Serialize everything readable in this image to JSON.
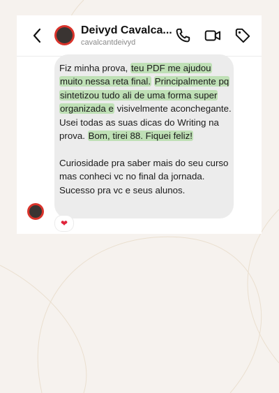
{
  "header": {
    "name": "Deivyd Cavalca...",
    "handle": "cavalcantdeivyd",
    "icons": [
      "back-arrow-icon",
      "phone-icon",
      "video-icon",
      "tag-icon"
    ]
  },
  "message": {
    "paragraph1": [
      {
        "text": "Fiz minha prova, ",
        "highlight": false
      },
      {
        "text": "teu PDF me ajudou muito nessa reta final.",
        "highlight": true
      },
      {
        "text": " ",
        "highlight": false
      },
      {
        "text": "Principalmente pq sintetizou tudo ali de uma forma super organizada e",
        "highlight": true
      },
      {
        "text": " visivelmente aconchegante. Usei todas as suas dicas do Writing na prova. ",
        "highlight": false
      },
      {
        "text": "Bom, tirei 88. Fiquei feliz!",
        "highlight": true
      }
    ],
    "paragraph2": "Curiosidade pra saber mais do seu curso mas conheci vc no final da jornada. Sucesso pra vc e seus alunos."
  },
  "reaction": {
    "emoji": "❤",
    "icon": "heart-reaction-icon"
  },
  "colors": {
    "page_background": "#f6f2ee",
    "bubble": "#ececec",
    "highlight": "#bfe0b6",
    "avatar_ring": "#d9332b",
    "heart": "#e0243b"
  }
}
